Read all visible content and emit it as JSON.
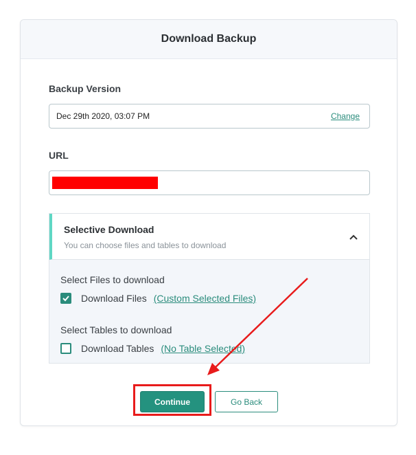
{
  "dialog": {
    "title": "Download Backup"
  },
  "backup_version": {
    "label": "Backup Version",
    "value": "Dec 29th 2020, 03:07 PM",
    "change_label": "Change"
  },
  "url": {
    "label": "URL"
  },
  "selective": {
    "title": "Selective Download",
    "subtitle": "You can choose files and tables to download",
    "files_section_label": "Select Files to download",
    "files_option_label": "Download Files",
    "files_link": "(Custom Selected Files)",
    "files_checked": true,
    "tables_section_label": "Select Tables to download",
    "tables_option_label": "Download Tables",
    "tables_link": "(No Table Selected)",
    "tables_checked": false
  },
  "buttons": {
    "continue": "Continue",
    "go_back": "Go Back"
  },
  "colors": {
    "accent": "#2a8c7c",
    "highlight": "#e81b1b",
    "redaction": "#ff0000"
  },
  "icons": {
    "collapse": "chevron-up-icon",
    "check": "check-icon"
  }
}
